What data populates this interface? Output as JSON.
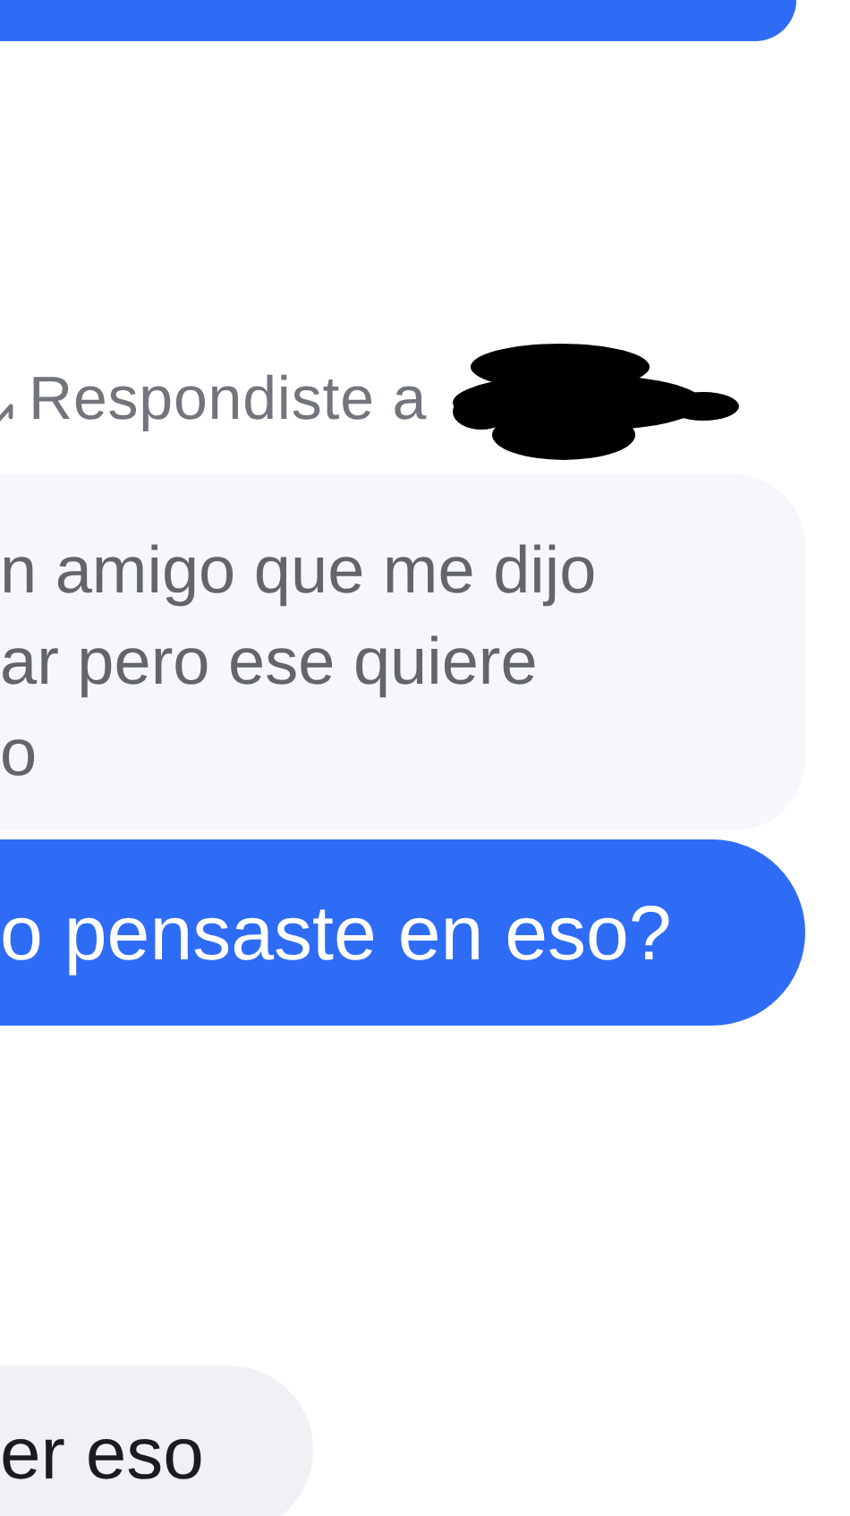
{
  "reply_header": {
    "label": "Respondiste a"
  },
  "messages": [
    {
      "kind": "sent"
    },
    {
      "kind": "quoted",
      "lines": [
        "n amigo que me dijo",
        "ar pero ese quiere",
        "o"
      ]
    },
    {
      "kind": "sent",
      "text": "o pensaste en eso?"
    },
    {
      "kind": "received",
      "text": "er eso"
    }
  ]
}
